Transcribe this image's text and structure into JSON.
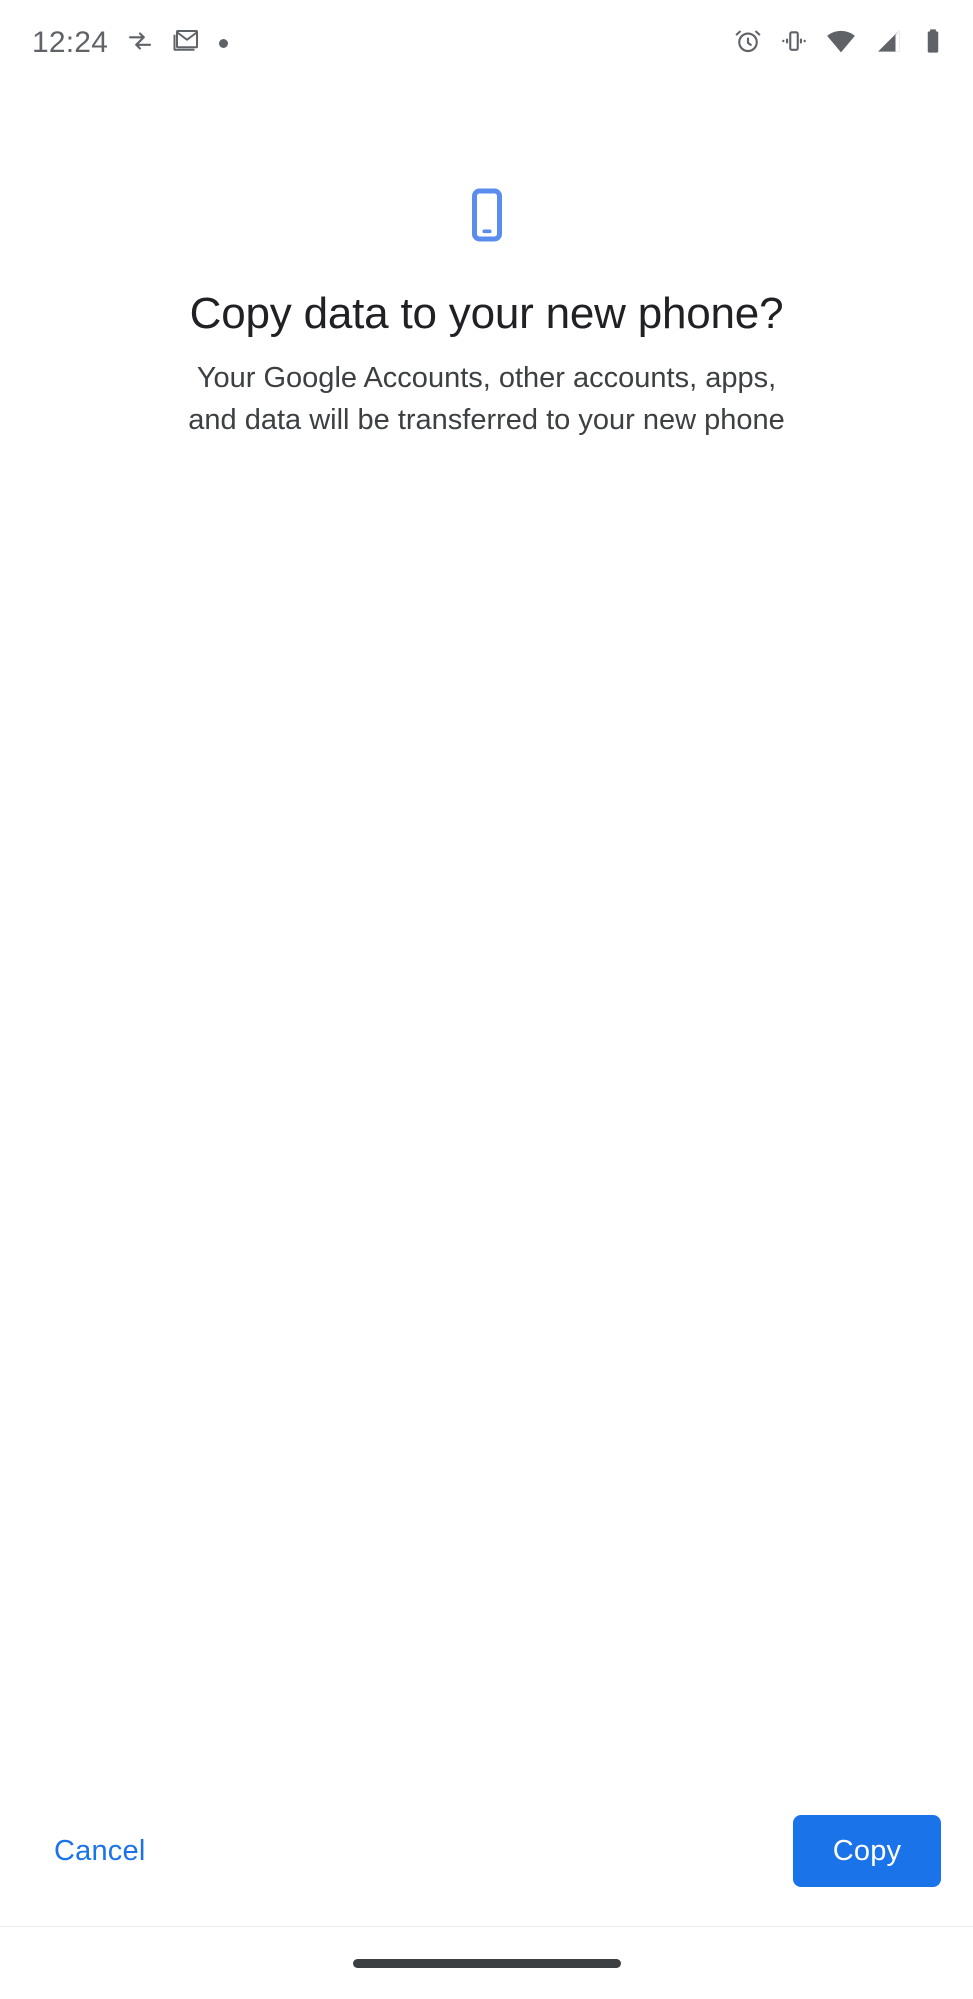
{
  "status_bar": {
    "clock": "12:24",
    "left_icons": [
      {
        "name": "data-transfer-icon",
        "label": "data transfer arrows"
      },
      {
        "name": "gmail-icon",
        "label": "Gmail notification"
      },
      {
        "name": "notification-dot-icon",
        "label": "notification dot"
      }
    ],
    "right_icons": [
      {
        "name": "alarm-icon",
        "label": "alarm set"
      },
      {
        "name": "vibrate-icon",
        "label": "ringer vibrate"
      },
      {
        "name": "wifi-icon",
        "label": "wifi full signal"
      },
      {
        "name": "cellular-signal-icon",
        "label": "cellular signal"
      },
      {
        "name": "battery-icon",
        "label": "battery full"
      }
    ],
    "icon_color": "#5f6368"
  },
  "main": {
    "hero_icon": "smartphone-icon",
    "title": "Copy data to your new phone?",
    "subtitle": "Your Google Accounts, other accounts, apps, and data will be transferred to your new phone"
  },
  "actions": {
    "cancel_label": "Cancel",
    "copy_label": "Copy"
  },
  "colors": {
    "accent": "#1a73e8",
    "hero_icon": "#5b8def",
    "title_text": "#202124",
    "body_text": "#3c4043",
    "nav_handle": "#3c4043",
    "divider": "#e8eaed"
  },
  "navigation": {
    "handle": "gesture-nav-handle"
  }
}
